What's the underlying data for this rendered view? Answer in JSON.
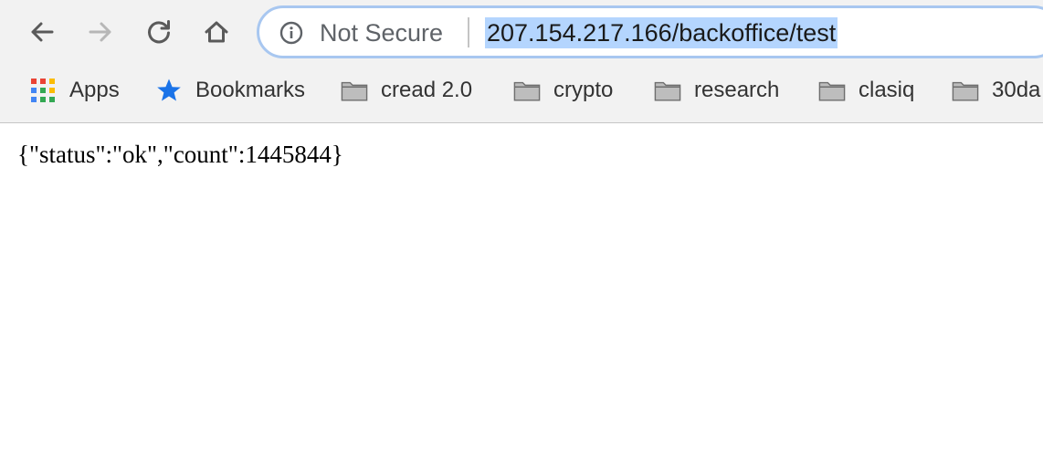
{
  "toolbar": {
    "back_icon": "arrow-left-icon",
    "forward_icon": "arrow-right-icon",
    "reload_icon": "reload-icon",
    "home_icon": "home-icon"
  },
  "omnibox": {
    "security_icon": "info-circle-icon",
    "security_label": "Not Secure",
    "url": "207.154.217.166/backoffice/test",
    "url_selected": true,
    "highlight_color": "#b4d5fe"
  },
  "bookmarks": [
    {
      "label": "Apps",
      "icon": "apps-grid-icon"
    },
    {
      "label": "Bookmarks",
      "icon": "star-icon"
    },
    {
      "label": "cread 2.0",
      "icon": "folder-icon"
    },
    {
      "label": "crypto",
      "icon": "folder-icon"
    },
    {
      "label": "research",
      "icon": "folder-icon"
    },
    {
      "label": "clasiq",
      "icon": "folder-icon"
    },
    {
      "label": "30da",
      "icon": "folder-icon"
    }
  ],
  "page": {
    "body_text": "{\"status\":\"ok\",\"count\":1445844}"
  },
  "colors": {
    "toolbar_bg": "#f2f2f2",
    "omnibox_focus_border": "#a8c7f0",
    "star_blue": "#1a73e8",
    "folder_gray": "#9a9a9a"
  }
}
